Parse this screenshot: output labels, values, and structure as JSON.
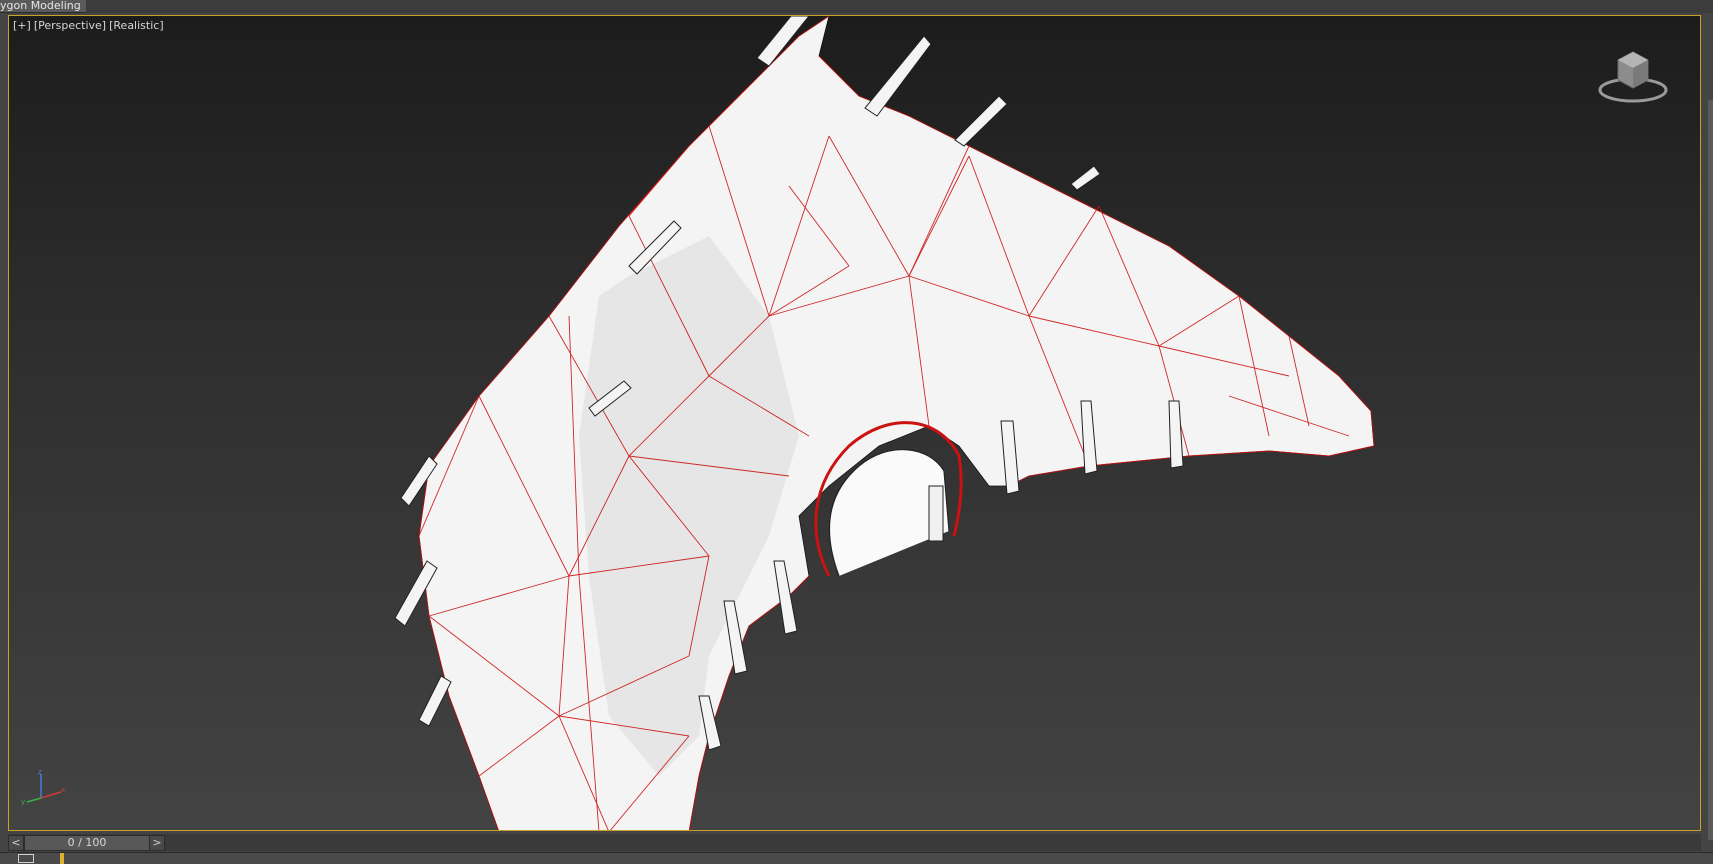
{
  "ribbon": {
    "tab_label": "ygon Modeling"
  },
  "viewport": {
    "labels": [
      "[+]",
      "[Perspective]",
      "[Realistic]"
    ],
    "border_color": "#c9a227",
    "wire_color": "#cc1111"
  },
  "icons": {
    "viewcube": "viewcube-icon",
    "axis": "axis-tripod-icon",
    "track": "track-view-icon"
  },
  "timeslider": {
    "prev_label": "<",
    "next_label": ">",
    "frame_display": "0 / 100"
  }
}
